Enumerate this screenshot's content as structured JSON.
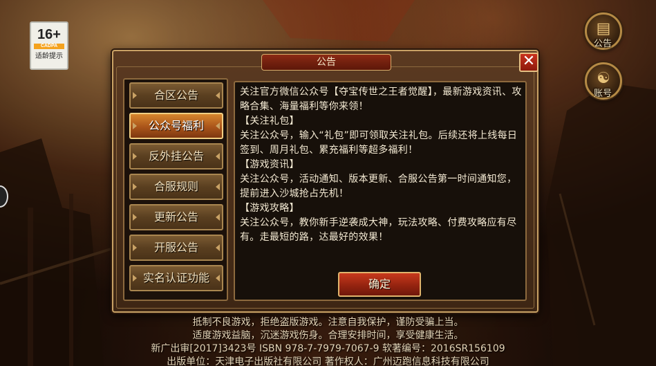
{
  "age_badge": {
    "rating": "16+",
    "org": "CADPA",
    "tip": "适龄提示"
  },
  "side_buttons": [
    {
      "label": "公告",
      "icon": "scroll-icon"
    },
    {
      "label": "账号",
      "icon": "account-icon"
    }
  ],
  "dialog": {
    "title": "公告",
    "close_label": "✕",
    "tabs": [
      {
        "label": "合区公告",
        "active": false
      },
      {
        "label": "公众号福利",
        "active": true
      },
      {
        "label": "反外挂公告",
        "active": false
      },
      {
        "label": "合服规则",
        "active": false
      },
      {
        "label": "更新公告",
        "active": false
      },
      {
        "label": "开服公告",
        "active": false
      },
      {
        "label": "实名认证功能",
        "active": false
      }
    ],
    "content_lines": [
      "关注官方微信公众号【夺宝传世之王者觉醒】，最新游戏资讯、攻略合集、海量福利等你来领！",
      "【关注礼包】",
      "关注公众号，输入“礼包”即可领取关注礼包。后续还将上线每日签到、周月礼包、累充福利等超多福利！",
      "【游戏资讯】",
      "关注公众号，活动通知、版本更新、合服公告第一时间通知您，提前进入沙城抢占先机！",
      "【游戏攻略】",
      "关注公众号，教你新手逆袭成大神，玩法攻略、付费攻略应有尽有。走最短的路，达最好的效果！"
    ],
    "confirm_label": "确定"
  },
  "footer": {
    "line1": "抵制不良游戏，拒绝盗版游戏。注意自我保护，谨防受骗上当。",
    "line2": "适度游戏益脑，沉迷游戏伤身。合理安排时间，享受健康生活。",
    "line3": "新广出审[2017]3423号  ISBN 978-7-7979-7067-9  软著编号：2016SR156109",
    "line4": "出版单位：天津电子出版社有限公司  著作权人：广州迈跑信息科技有限公司"
  }
}
